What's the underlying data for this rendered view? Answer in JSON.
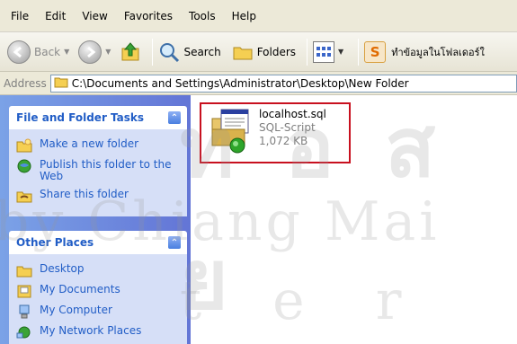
{
  "menu": [
    "File",
    "Edit",
    "View",
    "Favorites",
    "Tools",
    "Help"
  ],
  "toolbar": {
    "back_label": "Back",
    "search_label": "Search",
    "folders_label": "Folders",
    "extra_label": "ทำข้อมูลในโฟลเดอร์ใ"
  },
  "address": {
    "label": "Address",
    "path": "C:\\Documents and Settings\\Administrator\\Desktop\\New Folder"
  },
  "sidebar": {
    "tasks": {
      "title": "File and Folder Tasks",
      "items": [
        {
          "label": "Make a new folder",
          "icon": "new-folder-icon"
        },
        {
          "label": "Publish this folder to the Web",
          "icon": "publish-web-icon"
        },
        {
          "label": "Share this folder",
          "icon": "share-folder-icon"
        }
      ]
    },
    "places": {
      "title": "Other Places",
      "items": [
        {
          "label": "Desktop",
          "icon": "desktop-folder-icon"
        },
        {
          "label": "My Documents",
          "icon": "my-documents-icon"
        },
        {
          "label": "My Computer",
          "icon": "my-computer-icon"
        },
        {
          "label": "My Network Places",
          "icon": "network-places-icon"
        }
      ]
    }
  },
  "file": {
    "name": "localhost.sql",
    "type": "SQL-Script",
    "size": "1,072 KB"
  },
  "watermark": {
    "line1": "ท อ ส ย",
    "line2": "by Chiang Mai",
    "line3": "t  e  r"
  },
  "colors": {
    "sidebar_gradient_start": "#7ba2e7",
    "sidebar_gradient_end": "#6375d6",
    "link_blue": "#215dc6",
    "highlight_border": "#c8101f"
  }
}
